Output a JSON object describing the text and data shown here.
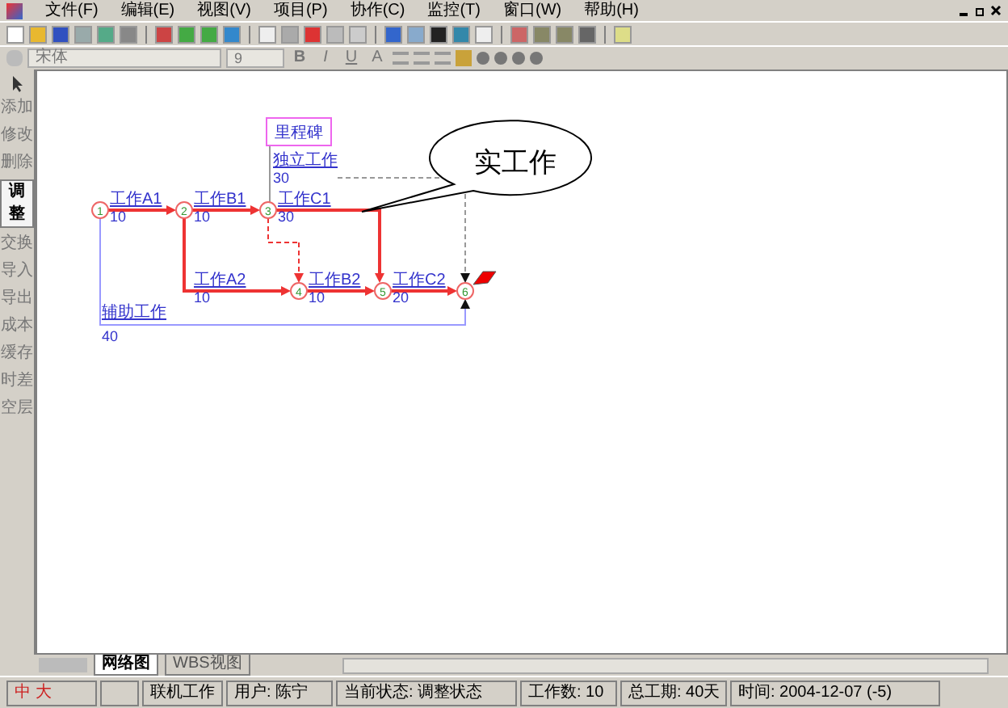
{
  "menu": [
    "文件(F)",
    "编辑(E)",
    "视图(V)",
    "项目(P)",
    "协作(C)",
    "监控(T)",
    "窗口(W)",
    "帮助(H)"
  ],
  "format_toolbar": {
    "font": "宋体",
    "size": "9",
    "buttons": [
      "B",
      "I",
      "U",
      "A"
    ]
  },
  "tools": [
    {
      "label": "添加",
      "selected": false
    },
    {
      "label": "修改",
      "selected": false
    },
    {
      "label": "删除",
      "selected": false
    },
    {
      "label": "调整",
      "selected": true
    },
    {
      "label": "交换",
      "selected": false
    },
    {
      "label": "导入",
      "selected": false
    },
    {
      "label": "导出",
      "selected": false
    },
    {
      "label": "成本",
      "selected": false
    },
    {
      "label": "缓存",
      "selected": false
    },
    {
      "label": "时差",
      "selected": false
    },
    {
      "label": "空层",
      "selected": false
    }
  ],
  "diagram": {
    "nodes": [
      "1",
      "2",
      "3",
      "4",
      "5",
      "6"
    ],
    "tasks": [
      {
        "name": "工作A1",
        "duration": "10"
      },
      {
        "name": "工作B1",
        "duration": "10"
      },
      {
        "name": "工作C1",
        "duration": "30"
      },
      {
        "name": "工作A2",
        "duration": "10"
      },
      {
        "name": "工作B2",
        "duration": "10"
      },
      {
        "name": "工作C2",
        "duration": "20"
      },
      {
        "name": "独立工作",
        "duration": "30"
      },
      {
        "name": "辅助工作",
        "duration": "40"
      }
    ],
    "milestone": "里程碑",
    "callout": "实工作"
  },
  "tabs": [
    {
      "label": "网络图",
      "selected": true
    },
    {
      "label": "WBS视图",
      "selected": false
    }
  ],
  "ime": [
    "中",
    "大"
  ],
  "status_bar": [
    "联机工作",
    "用户: 陈宁",
    "当前状态: 调整状态",
    "工作数: 10",
    "总工期: 40天",
    "时间: 2004-12-07 (-5)"
  ]
}
